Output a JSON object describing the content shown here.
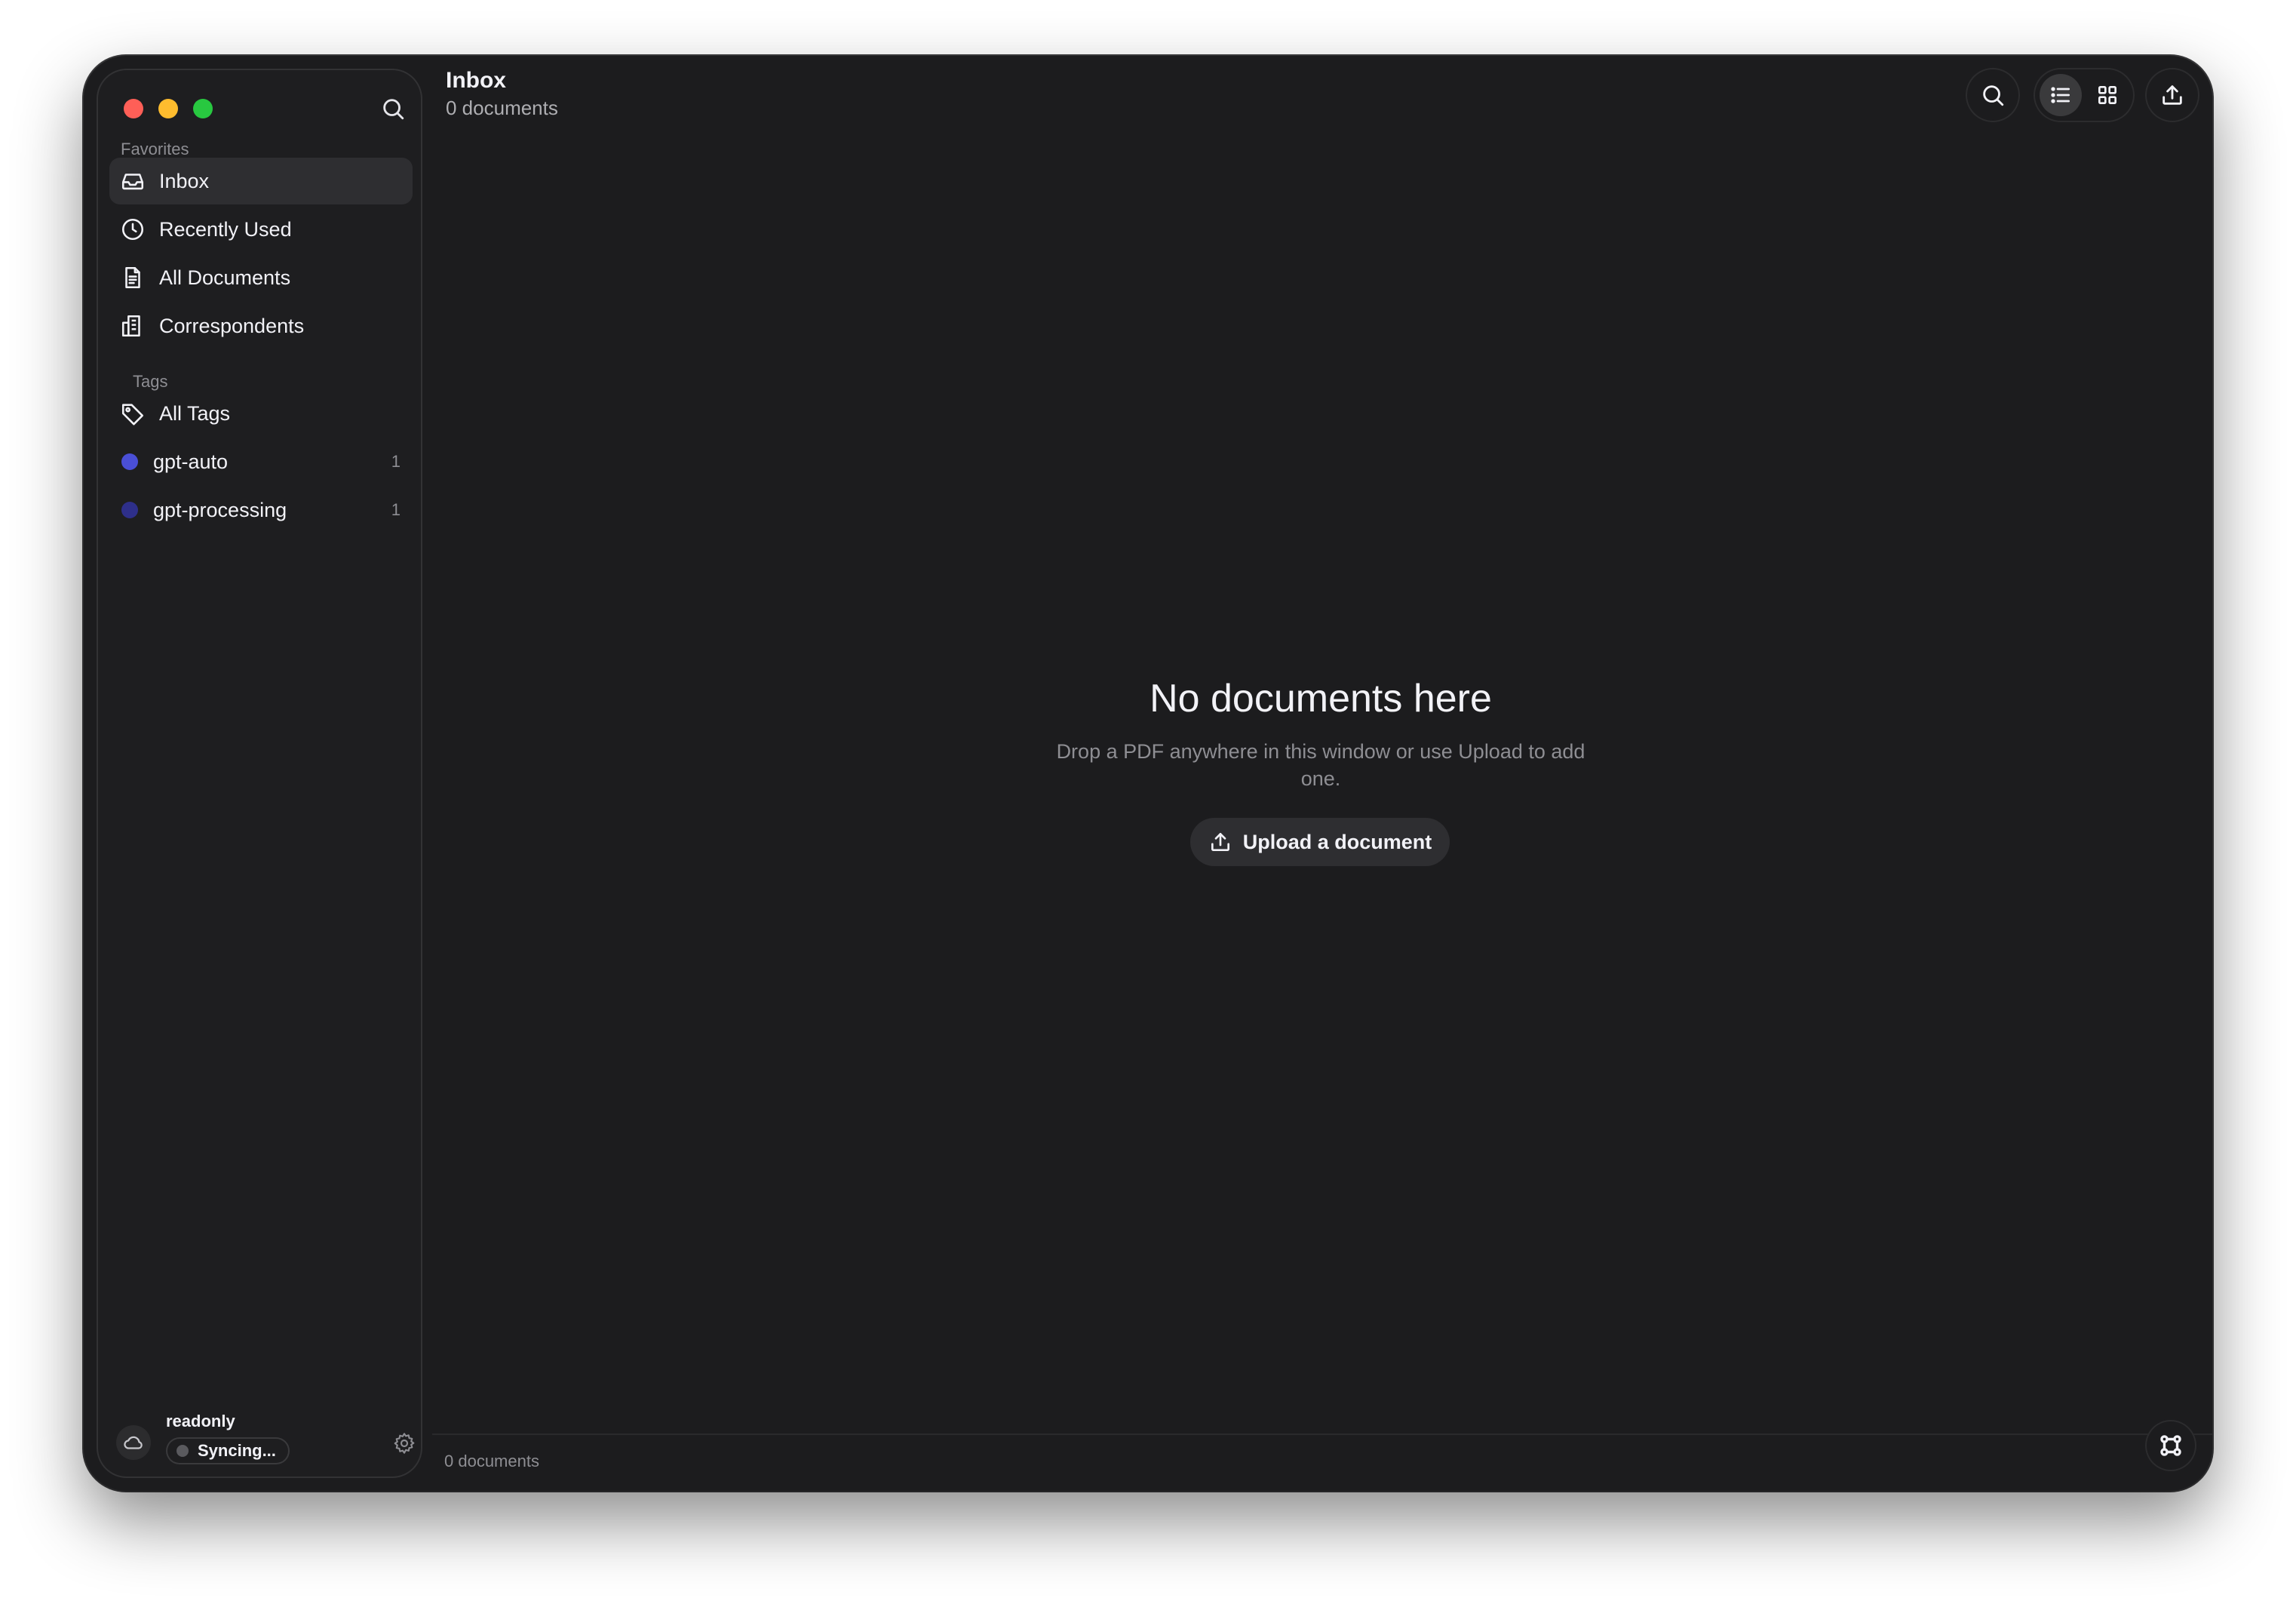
{
  "sidebar": {
    "favorites_label": "Favorites",
    "favorites": [
      {
        "label": "Inbox",
        "icon": "inbox-icon",
        "active": true
      },
      {
        "label": "Recently Used",
        "icon": "clock-icon"
      },
      {
        "label": "All Documents",
        "icon": "document-icon"
      },
      {
        "label": "Correspondents",
        "icon": "building-icon"
      }
    ],
    "tags_label": "Tags",
    "all_tags_label": "All Tags",
    "tags": [
      {
        "label": "gpt-auto",
        "count": "1",
        "color": "#4a4fd6"
      },
      {
        "label": "gpt-processing",
        "count": "1",
        "color": "#2e2f8a"
      }
    ],
    "footer": {
      "user": "readonly",
      "sync_status": "Syncing..."
    }
  },
  "header": {
    "title": "Inbox",
    "subtitle": "0 documents"
  },
  "empty_state": {
    "title": "No documents here",
    "text": "Drop a PDF anywhere in this window or use Upload to add one.",
    "button_label": "Upload a document"
  },
  "status_bar": {
    "count": "0 documents"
  },
  "colors": {
    "window_bg": "#1c1c1e",
    "sidebar_bg": "#1e1e20",
    "active_item_bg": "#2e2e31",
    "text_primary": "#f2f2f7",
    "text_secondary": "#8e8e93"
  }
}
